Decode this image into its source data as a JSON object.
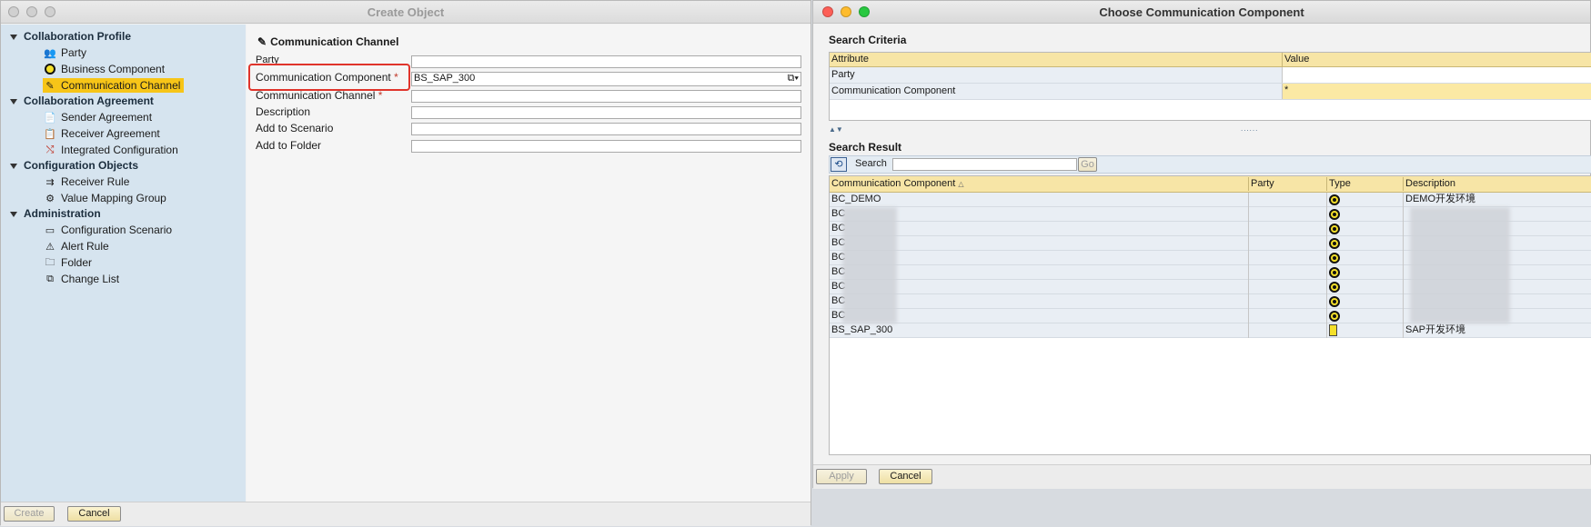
{
  "left_window": {
    "title": "Create Object",
    "nav": {
      "groups": [
        {
          "label": "Collaboration Profile",
          "items": [
            {
              "label": "Party",
              "icon": "party-icon"
            },
            {
              "label": "Business Component",
              "icon": "business-component-icon"
            },
            {
              "label": "Communication Channel",
              "icon": "communication-channel-icon",
              "selected": true
            }
          ]
        },
        {
          "label": "Collaboration Agreement",
          "items": [
            {
              "label": "Sender Agreement",
              "icon": "sender-agreement-icon"
            },
            {
              "label": "Receiver Agreement",
              "icon": "receiver-agreement-icon"
            },
            {
              "label": "Integrated Configuration",
              "icon": "integrated-configuration-icon"
            }
          ]
        },
        {
          "label": "Configuration Objects",
          "items": [
            {
              "label": "Receiver Rule",
              "icon": "receiver-rule-icon"
            },
            {
              "label": "Value Mapping Group",
              "icon": "value-mapping-group-icon"
            }
          ]
        },
        {
          "label": "Administration",
          "items": [
            {
              "label": "Configuration Scenario",
              "icon": "configuration-scenario-icon"
            },
            {
              "label": "Alert Rule",
              "icon": "alert-rule-icon"
            },
            {
              "label": "Folder",
              "icon": "folder-icon"
            },
            {
              "label": "Change List",
              "icon": "change-list-icon"
            }
          ]
        }
      ]
    },
    "form": {
      "header": "Communication Channel",
      "fields": [
        {
          "label": "Party",
          "required": "",
          "value": ""
        },
        {
          "label": "Communication Component",
          "required": "*",
          "value": "BS_SAP_300"
        },
        {
          "label": "Communication Channel",
          "required": "*",
          "value": ""
        },
        {
          "label": "Description",
          "required": "",
          "value": ""
        },
        {
          "label": "Add to Scenario",
          "required": "",
          "value": ""
        },
        {
          "label": "Add to Folder",
          "required": "",
          "value": ""
        }
      ]
    },
    "footer": {
      "create": "Create",
      "cancel": "Cancel"
    }
  },
  "right_window": {
    "title": "Choose Communication Component",
    "search_criteria": {
      "title": "Search Criteria",
      "columns": [
        "Attribute",
        "Value"
      ],
      "rows": [
        {
          "attribute": "Party",
          "value": ""
        },
        {
          "attribute": "Communication Component",
          "value": "*"
        }
      ]
    },
    "search_result": {
      "title": "Search Result",
      "search_label": "Search",
      "search_value": "",
      "go_label": "Go",
      "columns": [
        "Communication Component",
        "Party",
        "Type",
        "Description"
      ],
      "rows": [
        {
          "component": "BC_DEMO",
          "party": "",
          "type": "business-component",
          "description": "DEMO开发环境"
        },
        {
          "component": "BC",
          "party": "",
          "type": "business-component",
          "description": ""
        },
        {
          "component": "BC",
          "party": "",
          "type": "business-component",
          "description": ""
        },
        {
          "component": "BC",
          "party": "",
          "type": "business-component",
          "description": ""
        },
        {
          "component": "BC",
          "party": "",
          "type": "business-component",
          "description": ""
        },
        {
          "component": "BC",
          "party": "",
          "type": "business-component",
          "description": ""
        },
        {
          "component": "BC",
          "party": "",
          "type": "business-component",
          "description": ""
        },
        {
          "component": "BC",
          "party": "",
          "type": "business-component",
          "description": ""
        },
        {
          "component": "BC",
          "party": "",
          "type": "business-component",
          "description": ""
        },
        {
          "component": "BS_SAP_300",
          "party": "",
          "type": "business-system",
          "description": "SAP开发环境"
        }
      ]
    },
    "footer": {
      "apply": "Apply",
      "cancel": "Cancel"
    }
  }
}
